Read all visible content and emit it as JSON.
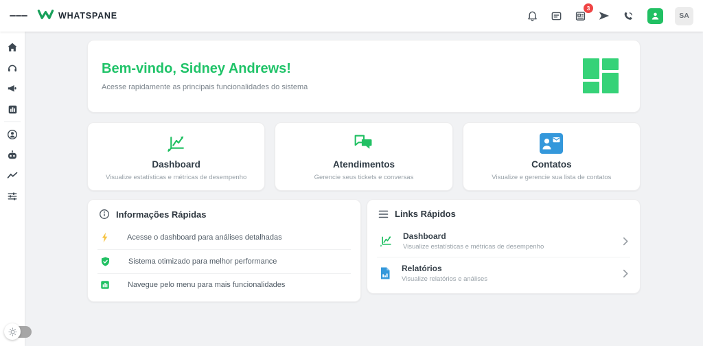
{
  "topbar": {
    "brand": "WHATSPANE",
    "badge_count": "3",
    "avatar_initials": "SA",
    "icons": [
      "menu-icon",
      "bell-icon",
      "chat-icon",
      "campaigns-icon",
      "send-icon",
      "phone-icon",
      "user-connect-icon"
    ]
  },
  "sidebar": {
    "icons": [
      "home-icon",
      "headset-icon",
      "megaphone-icon",
      "bar-chart-icon",
      "agent-icon",
      "robot-icon",
      "trend-icon",
      "sliders-icon"
    ],
    "theme_toggle_icon": "sun-icon"
  },
  "welcome": {
    "title": "Bem-vindo, Sidney Andrews!",
    "subtitle": "Acesse rapidamente as principais funcionalidades do sistema",
    "glyph": "dashboard-grid-icon"
  },
  "quick_cards": [
    {
      "title": "Dashboard",
      "subtitle": "Visualize estatísticas e métricas de desempenho",
      "icon": "line-chart-icon",
      "color": "#21c063"
    },
    {
      "title": "Atendimentos",
      "subtitle": "Gerencie seus tickets e conversas",
      "icon": "forum-icon",
      "color": "#21c063"
    },
    {
      "title": "Contatos",
      "subtitle": "Visualize e gerencie sua lista de contatos",
      "icon": "contact-card-icon",
      "color": "#3498db"
    }
  ],
  "quick_info": {
    "title": "Informações Rápidas",
    "header_icon": "info-icon",
    "items": [
      {
        "text": "Acesse o dashboard para análises detalhadas",
        "icon": "bolt-icon",
        "color": "#f6c445"
      },
      {
        "text": "Sistema otimizado para melhor performance",
        "icon": "shield-check-icon",
        "color": "#21c063"
      },
      {
        "text": "Navegue pelo menu para mais funcionalidades",
        "icon": "bar-chart-icon",
        "color": "#21c063"
      }
    ]
  },
  "quick_links": {
    "title": "Links Rápidos",
    "header_icon": "list-icon",
    "items": [
      {
        "title": "Dashboard",
        "subtitle": "Visualize estatísticas e métricas de desempenho",
        "icon": "line-chart-icon",
        "chevron": "chevron-right-icon"
      },
      {
        "title": "Relatórios",
        "subtitle": "Visualize relatórios e análises",
        "icon": "report-icon",
        "chevron": "chevron-right-icon"
      }
    ]
  },
  "colors": {
    "accent_green": "#21c063",
    "logo_green": "#18a05a",
    "blue": "#3498db",
    "yellow": "#f6c445",
    "badge_red": "#ef4444",
    "page_bg": "#f1f2f4"
  }
}
